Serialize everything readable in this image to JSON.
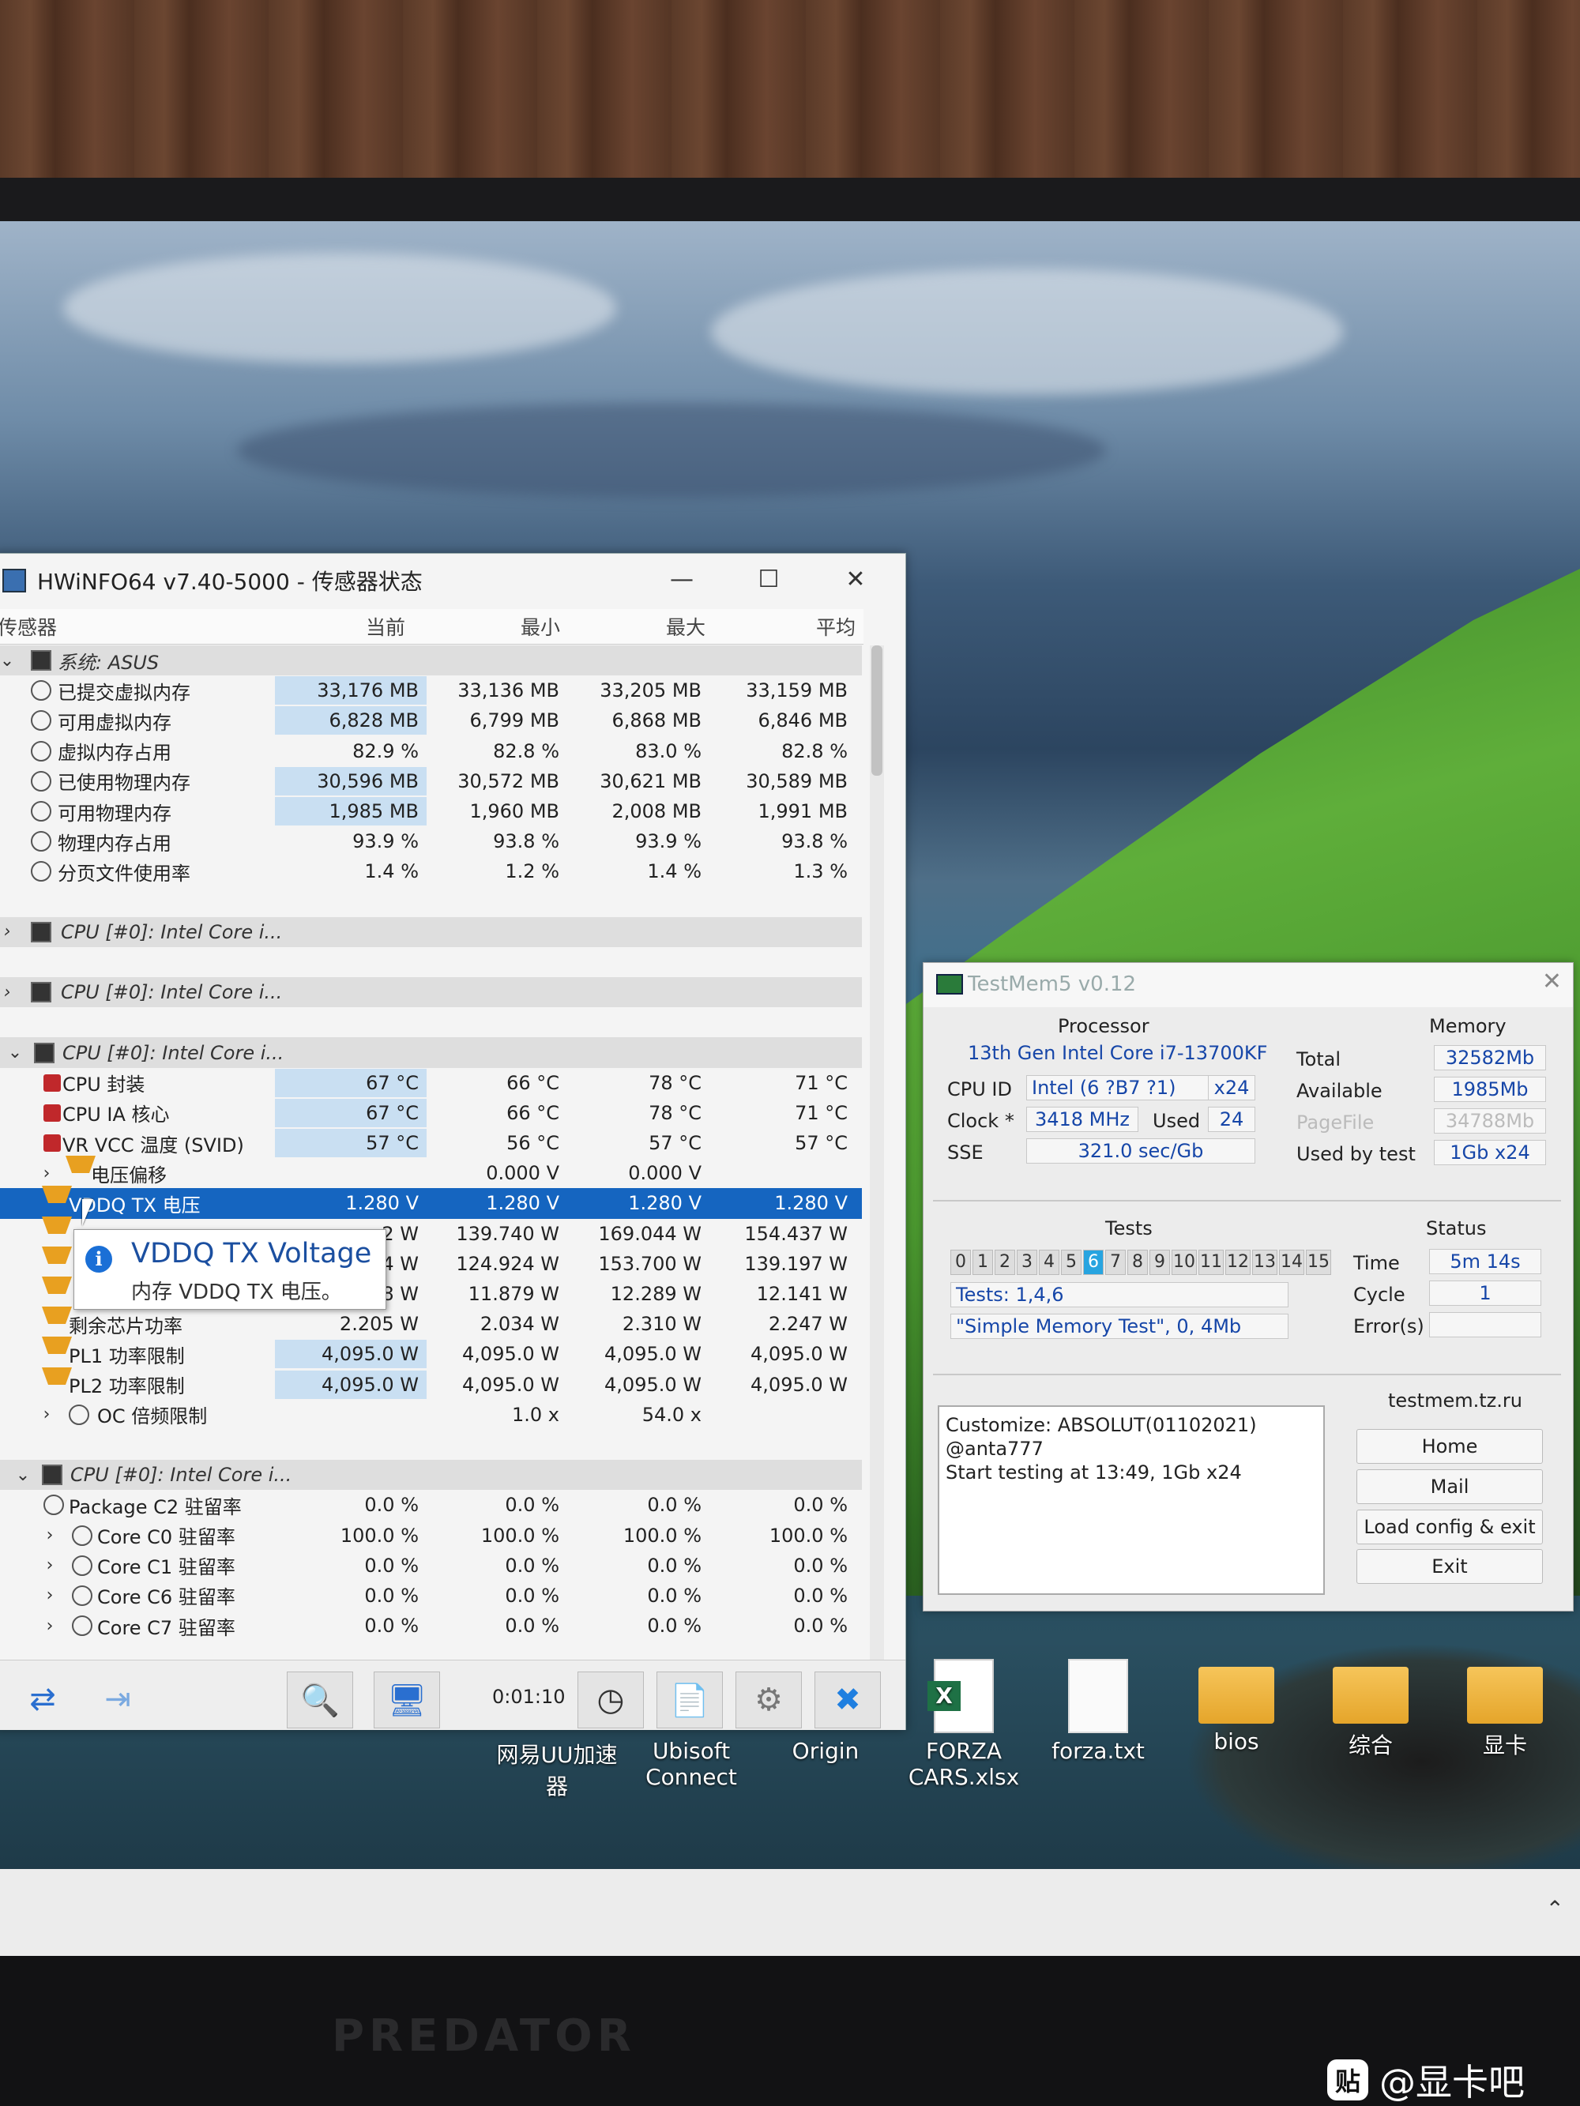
{
  "hwinfo": {
    "title": "HWiNFO64 v7.40-5000 - 传感器状态",
    "columns": [
      "传感器",
      "当前",
      "最小",
      "最大",
      "平均"
    ],
    "groups": [
      {
        "label": "系统: ASUS",
        "rows": [
          {
            "name": "已提交虚拟内存",
            "cur": "33,176 MB",
            "min": "33,136 MB",
            "max": "33,205 MB",
            "avg": "33,159 MB"
          },
          {
            "name": "可用虚拟内存",
            "cur": "6,828 MB",
            "min": "6,799 MB",
            "max": "6,868 MB",
            "avg": "6,846 MB"
          },
          {
            "name": "虚拟内存占用",
            "cur": "82.9 %",
            "min": "82.8 %",
            "max": "83.0 %",
            "avg": "82.8 %"
          },
          {
            "name": "已使用物理内存",
            "cur": "30,596 MB",
            "min": "30,572 MB",
            "max": "30,621 MB",
            "avg": "30,589 MB"
          },
          {
            "name": "可用物理内存",
            "cur": "1,985 MB",
            "min": "1,960 MB",
            "max": "2,008 MB",
            "avg": "1,991 MB"
          },
          {
            "name": "物理内存占用",
            "cur": "93.9 %",
            "min": "93.8 %",
            "max": "93.9 %",
            "avg": "93.8 %"
          },
          {
            "name": "分页文件使用率",
            "cur": "1.4 %",
            "min": "1.2 %",
            "max": "1.4 %",
            "avg": "1.3 %"
          }
        ]
      },
      {
        "label": "CPU [#0]: Intel Core i..."
      },
      {
        "label": "CPU [#0]: Intel Core i..."
      },
      {
        "label": "CPU [#0]: Intel Core i...",
        "rows": [
          {
            "name": "CPU 封装",
            "cur": "67 °C",
            "min": "66 °C",
            "max": "78 °C",
            "avg": "71 °C"
          },
          {
            "name": "CPU IA 核心",
            "cur": "67 °C",
            "min": "66 °C",
            "max": "78 °C",
            "avg": "71 °C"
          },
          {
            "name": "VR VCC 温度 (SVID)",
            "cur": "57 °C",
            "min": "56 °C",
            "max": "57 °C",
            "avg": "57 °C"
          },
          {
            "name": "电压偏移",
            "cur": "",
            "min": "0.000 V",
            "max": "0.000 V",
            "avg": ""
          },
          {
            "name": "VDDQ TX 电压",
            "cur": "1.280 V",
            "min": "1.280 V",
            "max": "1.280 V",
            "avg": "1.280 V"
          },
          {
            "name": "",
            "cur": "2 W",
            "min": "139.740 W",
            "max": "169.044 W",
            "avg": "154.437 W"
          },
          {
            "name": "",
            "cur": "4 W",
            "min": "124.924 W",
            "max": "153.700 W",
            "avg": "139.197 W"
          },
          {
            "name": "",
            "cur": "8 W",
            "min": "11.879 W",
            "max": "12.289 W",
            "avg": "12.141 W"
          },
          {
            "name": "剩余芯片功率",
            "cur": "2.205 W",
            "min": "2.034 W",
            "max": "2.310 W",
            "avg": "2.247 W"
          },
          {
            "name": "PL1 功率限制",
            "cur": "4,095.0 W",
            "min": "4,095.0 W",
            "max": "4,095.0 W",
            "avg": "4,095.0 W"
          },
          {
            "name": "PL2 功率限制",
            "cur": "4,095.0 W",
            "min": "4,095.0 W",
            "max": "4,095.0 W",
            "avg": "4,095.0 W"
          },
          {
            "name": "OC 倍频限制",
            "cur": "",
            "min": "1.0 x",
            "max": "54.0 x",
            "avg": ""
          }
        ]
      },
      {
        "label": "CPU [#0]: Intel Core i...",
        "rows": [
          {
            "name": "Package C2 驻留率",
            "cur": "0.0 %",
            "min": "0.0 %",
            "max": "0.0 %",
            "avg": "0.0 %"
          },
          {
            "name": "Core C0 驻留率",
            "cur": "100.0 %",
            "min": "100.0 %",
            "max": "100.0 %",
            "avg": "100.0 %"
          },
          {
            "name": "Core C1 驻留率",
            "cur": "0.0 %",
            "min": "0.0 %",
            "max": "0.0 %",
            "avg": "0.0 %"
          },
          {
            "name": "Core C6 驻留率",
            "cur": "0.0 %",
            "min": "0.0 %",
            "max": "0.0 %",
            "avg": "0.0 %"
          },
          {
            "name": "Core C7 驻留率",
            "cur": "0.0 %",
            "min": "0.0 %",
            "max": "0.0 %",
            "avg": "0.0 %"
          }
        ]
      }
    ],
    "tooltip": {
      "title": "VDDQ TX Voltage",
      "desc": "内存 VDDQ TX 电压。"
    },
    "elapsed": "0:01:10"
  },
  "testmem": {
    "title": "TestMem5 v0.12",
    "processor_label": "Processor",
    "processor": "13th Gen Intel Core i7-13700KF",
    "cpuid_label": "CPU ID",
    "cpuid": "Intel  (6 ?B7 ?1)",
    "cpuid_threads": "x24",
    "clock_label": "Clock *",
    "clock": "3418 MHz",
    "used_label": "Used",
    "used": "24",
    "sse_label": "SSE",
    "sse": "321.0 sec/Gb",
    "memory_label": "Memory",
    "total_label": "Total",
    "total": "32582Mb",
    "available_label": "Available",
    "available": "1985Mb",
    "pagefile_label": "PageFile",
    "pagefile": "34788Mb",
    "usedbytest_label": "Used by test",
    "usedbytest": "1Gb x24",
    "tests_label": "Tests",
    "test_numbers": [
      "0",
      "1",
      "2",
      "3",
      "4",
      "5",
      "6",
      "7",
      "8",
      "9",
      "10",
      "11",
      "12",
      "13",
      "14",
      "15"
    ],
    "active_test": "6",
    "tests_line": "Tests: 1,4,6",
    "current_test": "\"Simple Memory Test\", 0, 4Mb",
    "status_label": "Status",
    "time_label": "Time",
    "time": "5m 14s",
    "cycle_label": "Cycle",
    "cycle": "1",
    "errors_label": "Error(s)",
    "errors": "",
    "site": "testmem.tz.ru",
    "log_line1": "Customize: ABSOLUT(01102021) @anta777",
    "log_line2": "Start testing at 13:49, 1Gb x24",
    "buttons": {
      "home": "Home",
      "mail": "Mail",
      "load": "Load config & exit",
      "exit": "Exit"
    }
  },
  "desktop_icons": [
    {
      "label": "网易UU加速器",
      "icon": "uu-icon"
    },
    {
      "label": "Ubisoft Connect",
      "icon": "ubisoft-icon"
    },
    {
      "label": "Origin",
      "icon": "origin-icon"
    },
    {
      "label": "FORZA CARS.xlsx",
      "icon": "excel-file-icon"
    },
    {
      "label": "forza.txt",
      "icon": "text-file-icon"
    },
    {
      "label": "bios",
      "icon": "folder-icon"
    },
    {
      "label": "综合",
      "icon": "folder-icon"
    },
    {
      "label": "显卡",
      "icon": "folder-icon"
    }
  ],
  "watermark": {
    "badge": "贴",
    "text": "@显卡吧"
  },
  "monitor_brand": "PREDATOR"
}
